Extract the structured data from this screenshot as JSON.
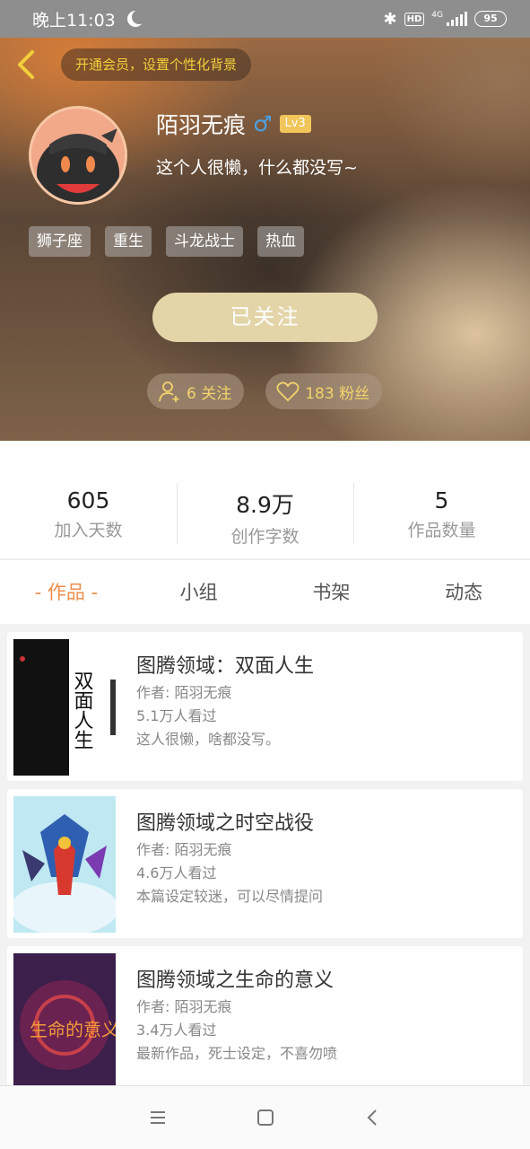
{
  "status_bar": {
    "time": "晚上11:03",
    "hd": "HD",
    "network": "4G",
    "battery": "95"
  },
  "header": {
    "vip_banner": "开通会员，设置个性化背景"
  },
  "profile": {
    "username": "陌羽无痕",
    "gender_symbol": "♂",
    "level": "Lv3",
    "bio": "这个人很懒，什么都没写~",
    "tags": [
      "狮子座",
      "重生",
      "斗龙战士",
      "热血"
    ],
    "follow_button": "已关注",
    "following": "6 关注",
    "fans": "183 粉丝"
  },
  "stats": [
    {
      "value": "605",
      "label": "加入天数"
    },
    {
      "value": "8.9万",
      "label": "创作字数"
    },
    {
      "value": "5",
      "label": "作品数量"
    }
  ],
  "tabs": [
    "- 作品 -",
    "小组",
    "书架",
    "动态"
  ],
  "works": [
    {
      "title": "图腾领域：双面人生",
      "author": "作者: 陌羽无痕",
      "views": "5.1万人看过",
      "desc": "这人很懒，啥都没写。",
      "cover_text": "双面人生"
    },
    {
      "title": "图腾领域之时空战役",
      "author": "作者: 陌羽无痕",
      "views": "4.6万人看过",
      "desc": "本篇设定较迷，可以尽情提问"
    },
    {
      "title": "图腾领域之生命的意义",
      "author": "作者: 陌羽无痕",
      "views": "3.4万人看过",
      "desc": "最新作品，死士设定，不喜勿喷",
      "cover_text": "生命的意义"
    }
  ],
  "icons": [
    "moon-icon",
    "bluetooth-icon",
    "signal-icon",
    "back-arrow-icon",
    "person-add-icon",
    "heart-icon",
    "menu-icon",
    "home-icon",
    "nav-back-icon"
  ]
}
